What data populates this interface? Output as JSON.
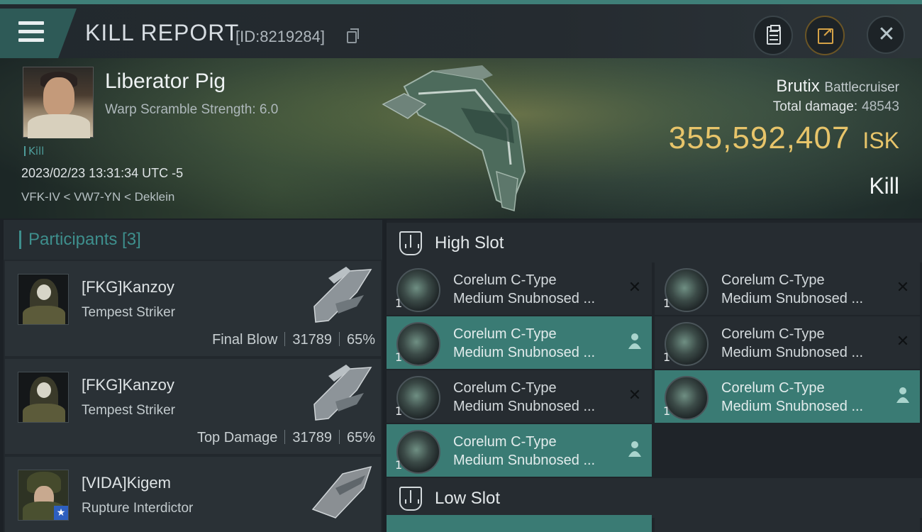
{
  "header": {
    "title": "KILL REPORT",
    "report_id": "[ID:8219284]"
  },
  "victim": {
    "name": "Liberator Pig",
    "warp_scramble": "Warp Scramble Strength: 6.0",
    "tag": "Kill",
    "datetime": "2023/02/23 13:31:34 UTC -5",
    "location": "VFK-IV < VW7-YN < Deklein",
    "ship": "Brutix",
    "ship_class": "Battlecruiser",
    "total_damage_label": "Total damage:",
    "total_damage": "48543",
    "isk_value": "355,592,407",
    "isk_unit": "ISK",
    "result": "Kill"
  },
  "participants": {
    "title": "Participants [3]",
    "items": [
      {
        "name": "[FKG]Kanzoy",
        "ship": "Tempest Striker",
        "role": "Final Blow",
        "damage": "31789",
        "percent": "65%"
      },
      {
        "name": "[FKG]Kanzoy",
        "ship": "Tempest Striker",
        "role": "Top Damage",
        "damage": "31789",
        "percent": "65%"
      },
      {
        "name": "[VIDA]Kigem",
        "ship": "Rupture Interdictor",
        "role": "",
        "damage": "",
        "percent": ""
      }
    ]
  },
  "fittings": {
    "high_slot_title": "High Slot",
    "low_slot_title": "Low Slot",
    "high_slot": [
      {
        "qty": "1",
        "line1": "Corelum C-Type",
        "line2": "Medium Snubnosed ...",
        "status": "destroyed",
        "icon": "x-icon"
      },
      {
        "qty": "1",
        "line1": "Corelum C-Type",
        "line2": "Medium Snubnosed ...",
        "status": "destroyed",
        "icon": "x-icon"
      },
      {
        "qty": "1",
        "line1": "Corelum C-Type",
        "line2": "Medium Snubnosed ...",
        "status": "dropped",
        "icon": "person-icon"
      },
      {
        "qty": "1",
        "line1": "Corelum C-Type",
        "line2": "Medium Snubnosed ...",
        "status": "destroyed",
        "icon": "x-icon"
      },
      {
        "qty": "1",
        "line1": "Corelum C-Type",
        "line2": "Medium Snubnosed ...",
        "status": "destroyed",
        "icon": "x-icon"
      },
      {
        "qty": "1",
        "line1": "Corelum C-Type",
        "line2": "Medium Snubnosed ...",
        "status": "dropped",
        "icon": "person-icon"
      },
      {
        "qty": "1",
        "line1": "Corelum C-Type",
        "line2": "Medium Snubnosed ...",
        "status": "dropped",
        "icon": "person-icon"
      }
    ]
  },
  "colors": {
    "accent_teal": "#3a7b74",
    "isk_gold": "#e7c46a",
    "header_stripe": "#3f7f78"
  }
}
